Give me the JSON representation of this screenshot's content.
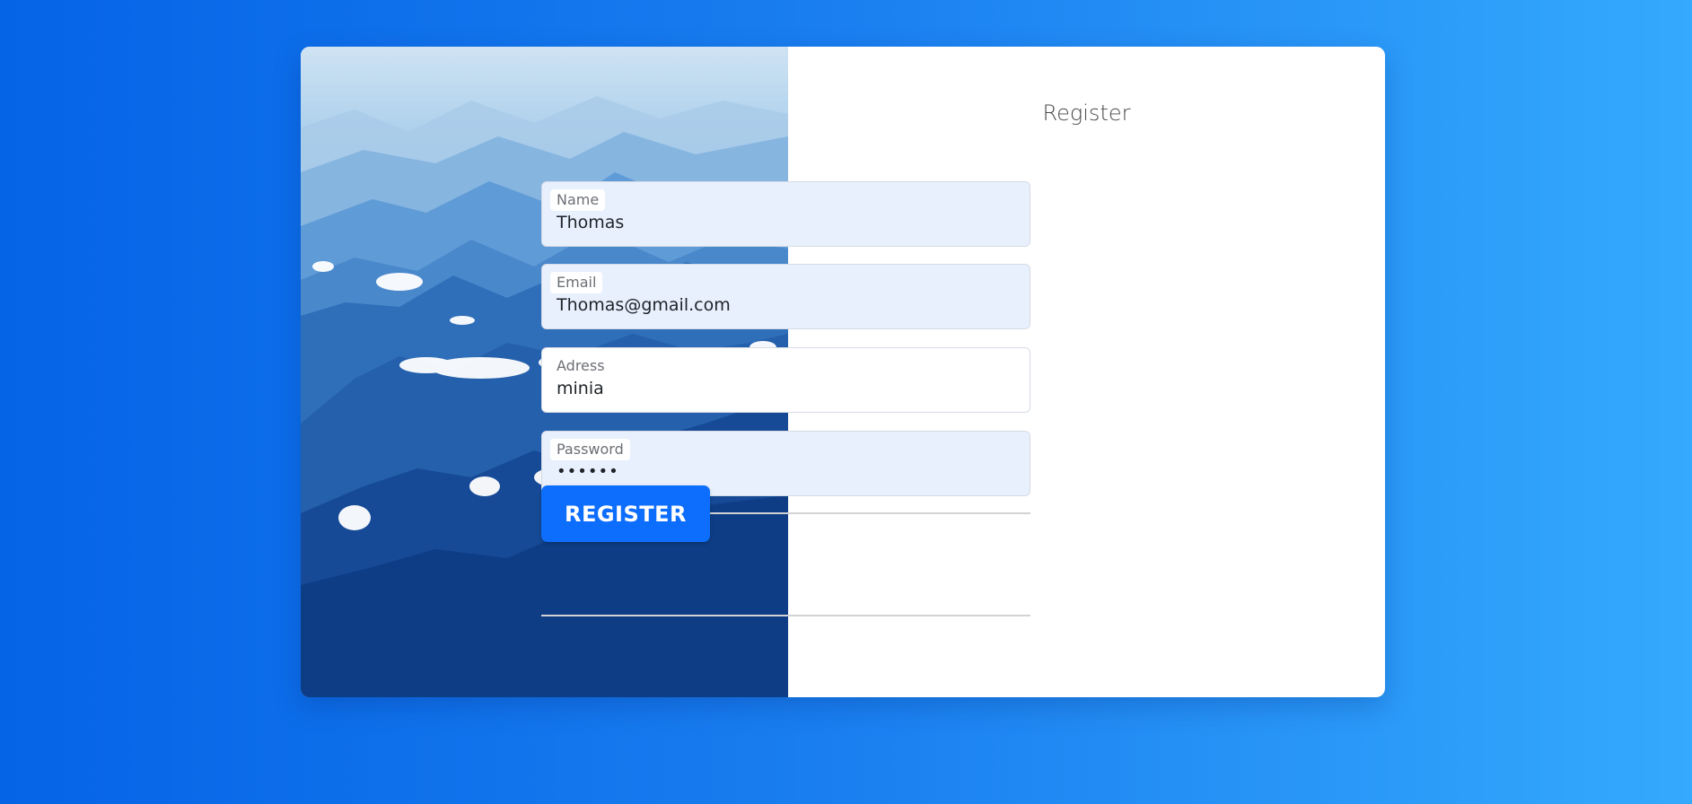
{
  "form": {
    "title": "Register",
    "fields": [
      {
        "label": "Name",
        "value": "Thomas",
        "type": "text",
        "autofilled": true
      },
      {
        "label": "Email",
        "value": "Thomas@gmail.com",
        "type": "email",
        "autofilled": true
      },
      {
        "label": "Adress",
        "value": "minia",
        "type": "text",
        "autofilled": false
      },
      {
        "label": "Password",
        "value": "••••••",
        "type": "password",
        "autofilled": true
      }
    ],
    "submit_label": "REGISTER"
  },
  "colors": {
    "background_start": "#0563e6",
    "background_end": "#34a9fd",
    "button": "#0d6efd",
    "autofill": "#e8f0fe"
  },
  "hero": {
    "image": "mountain-clouds-illustration"
  }
}
